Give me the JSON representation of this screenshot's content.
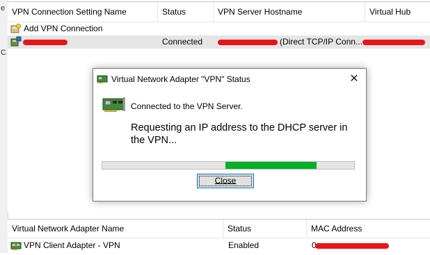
{
  "left_glyphs": [
    "e",
    "C"
  ],
  "vpn_list": {
    "columns": [
      "VPN Connection Setting Name",
      "Status",
      "VPN Server Hostname",
      "Virtual Hub"
    ],
    "rows": [
      {
        "name": "Add VPN Connection",
        "status": "",
        "hostname": "",
        "hub": ""
      },
      {
        "name": "",
        "status": "Connected",
        "hostname": "(Direct TCP/IP Conn...",
        "hub": ""
      }
    ]
  },
  "adapter_list": {
    "columns": [
      "Virtual Network Adapter Name",
      "Status",
      "MAC Address"
    ],
    "rows": [
      {
        "name": "VPN Client Adapter - VPN",
        "status": "Enabled",
        "mac": "0"
      }
    ]
  },
  "dialog": {
    "title": "Virtual Network Adapter \"VPN\" Status",
    "close_glyph": "✕",
    "message1": "Connected to the VPN Server.",
    "message2": "Requesting an IP address to the DHCP server in the VPN...",
    "progress": {
      "start": 0.49,
      "end": 0.85
    },
    "close_button_label": "Close"
  },
  "colors": {
    "progress": "#06b025",
    "redaction": "#e8141c",
    "selection": "#e5e5e5"
  }
}
